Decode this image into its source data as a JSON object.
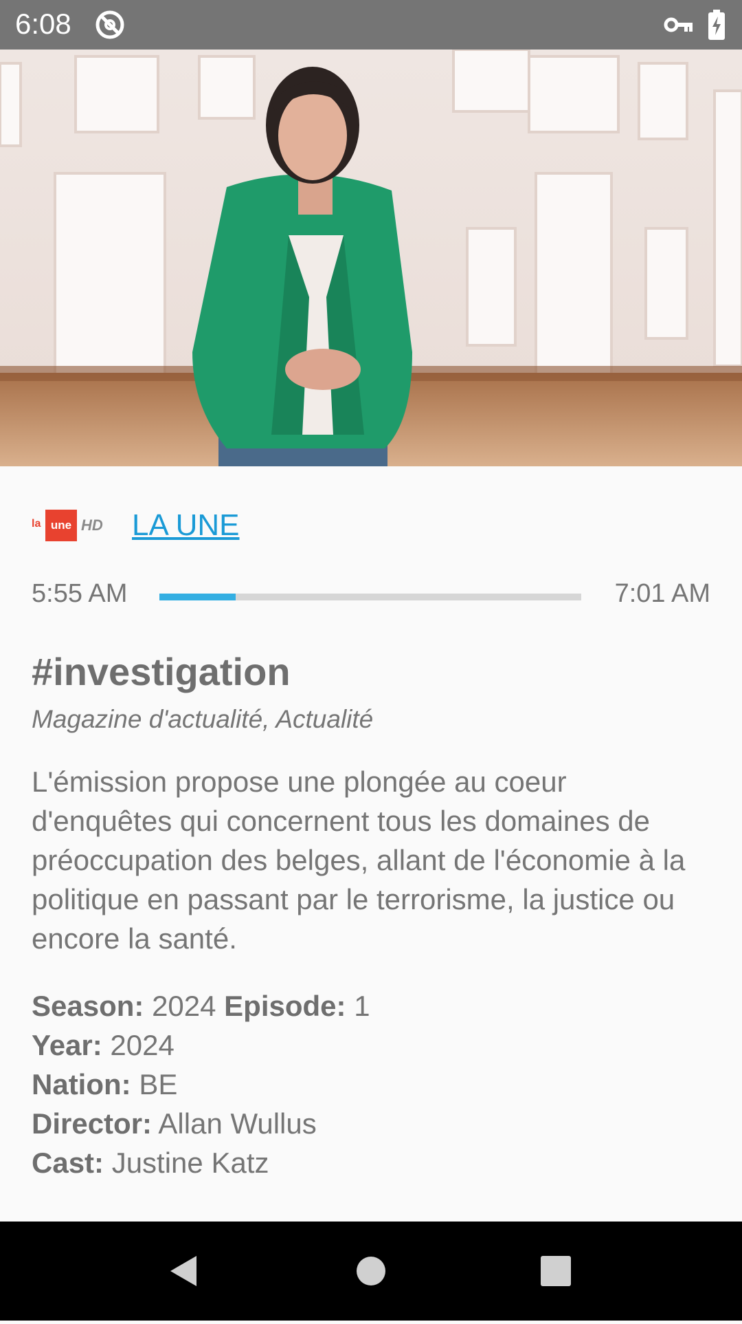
{
  "status_bar": {
    "time": "6:08",
    "icons": [
      "sync-circle-icon",
      "vpn-key-icon",
      "battery-charging-icon"
    ]
  },
  "hero": {
    "description_icon": "presenter-photo"
  },
  "channel": {
    "logo_text_small": "la",
    "logo_text_main": "une",
    "logo_hd": "HD",
    "name": "LA UNE"
  },
  "schedule": {
    "start": "5:55 AM",
    "end": "7:01 AM",
    "progress_fraction": 0.18,
    "accent_color": "#33aee2"
  },
  "program": {
    "title": "#investigation",
    "genre": "Magazine d'actualité, Actualité",
    "description": "L'émission propose une plongée au coeur d'enquêtes qui concernent tous les domaines de préoccupation des belges, allant de l'économie à la politique en passant par le terrorisme, la justice ou encore la santé."
  },
  "details": {
    "season_label": "Season:",
    "season_value": "2024",
    "episode_label": "Episode:",
    "episode_value": "1",
    "year_label": "Year:",
    "year_value": "2024",
    "nation_label": "Nation:",
    "nation_value": "BE",
    "director_label": "Director:",
    "director_value": "Allan Wullus",
    "cast_label": "Cast:",
    "cast_value": "Justine Katz"
  },
  "nav_bar": {
    "icons": [
      "back-icon",
      "home-icon",
      "recents-icon"
    ]
  }
}
